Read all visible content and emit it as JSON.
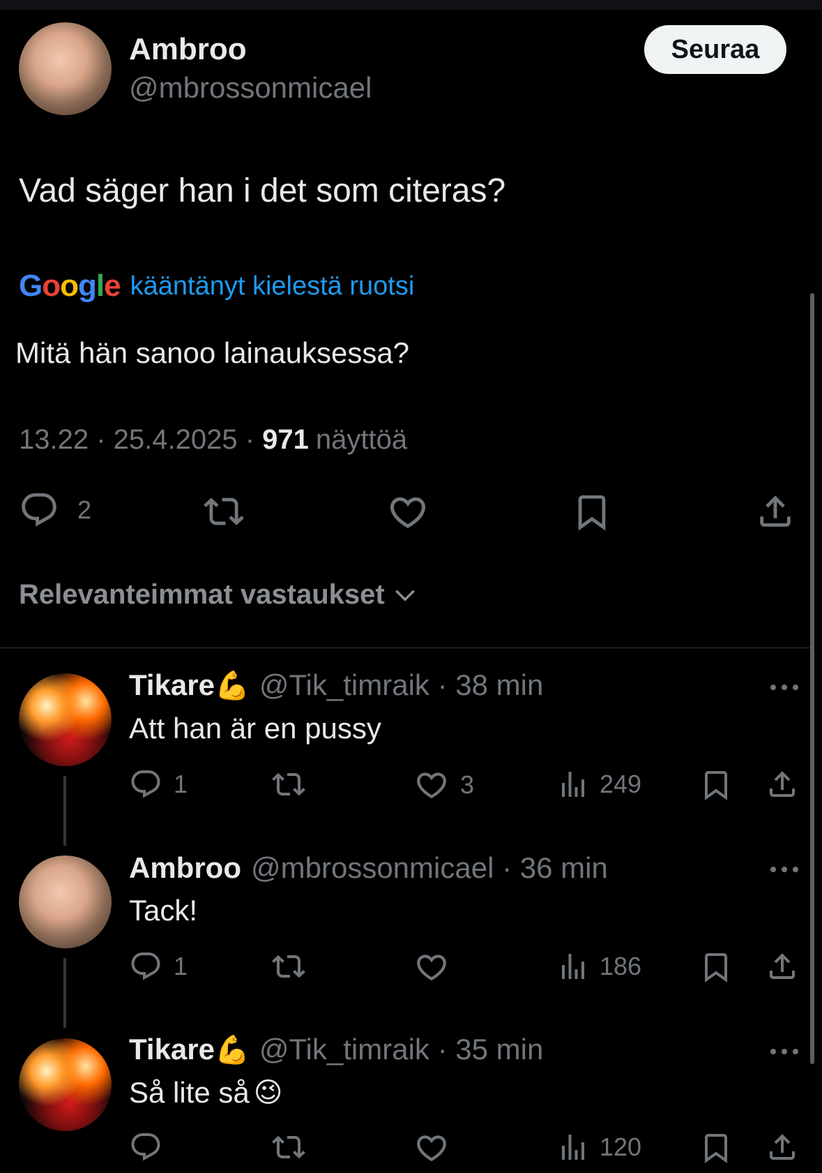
{
  "main_tweet": {
    "author_name": "Ambroo",
    "author_handle": "@mbrossonmicael",
    "follow_label": "Seuraa",
    "text": "Vad säger han i det som citeras?",
    "translation_source": "kääntänyt kielestä ruotsi",
    "translated_text": "Mitä hän sanoo lainauksessa?",
    "time": "13.22",
    "date": "25.4.2025",
    "views_count": "971",
    "views_label": "näyttöä",
    "reply_count": "2"
  },
  "google_logo": {
    "letters": [
      "G",
      "o",
      "o",
      "g",
      "l",
      "e"
    ]
  },
  "replies_sort_label": "Relevanteimmat vastaukset",
  "replies": [
    {
      "author_name": "Tikare",
      "emoji": "💪",
      "handle": "@Tik_timraik",
      "time": "38 min",
      "text": "Att han är en pussy",
      "reply_count": "1",
      "like_count": "3",
      "view_count": "249"
    },
    {
      "author_name": "Ambroo",
      "handle": "@mbrossonmicael",
      "time": "36 min",
      "text": "Tack!",
      "reply_count": "1",
      "like_count": "",
      "view_count": "186"
    },
    {
      "author_name": "Tikare",
      "emoji": "💪",
      "handle": "@Tik_timraik",
      "time": "35 min",
      "text": "Så lite så",
      "text_emoji": "😉",
      "reply_count": "",
      "like_count": "",
      "view_count": "120"
    }
  ],
  "separator": "·",
  "icons": [
    "reply-icon",
    "retweet-icon",
    "like-icon",
    "bookmark-icon",
    "share-icon",
    "views-icon",
    "more-icon",
    "chevron-down-icon"
  ],
  "colors": {
    "background": "#000000",
    "text": "#e7e9ea",
    "muted": "#71767b",
    "link": "#1d9bf0",
    "follow_bg": "#eff3f4"
  }
}
